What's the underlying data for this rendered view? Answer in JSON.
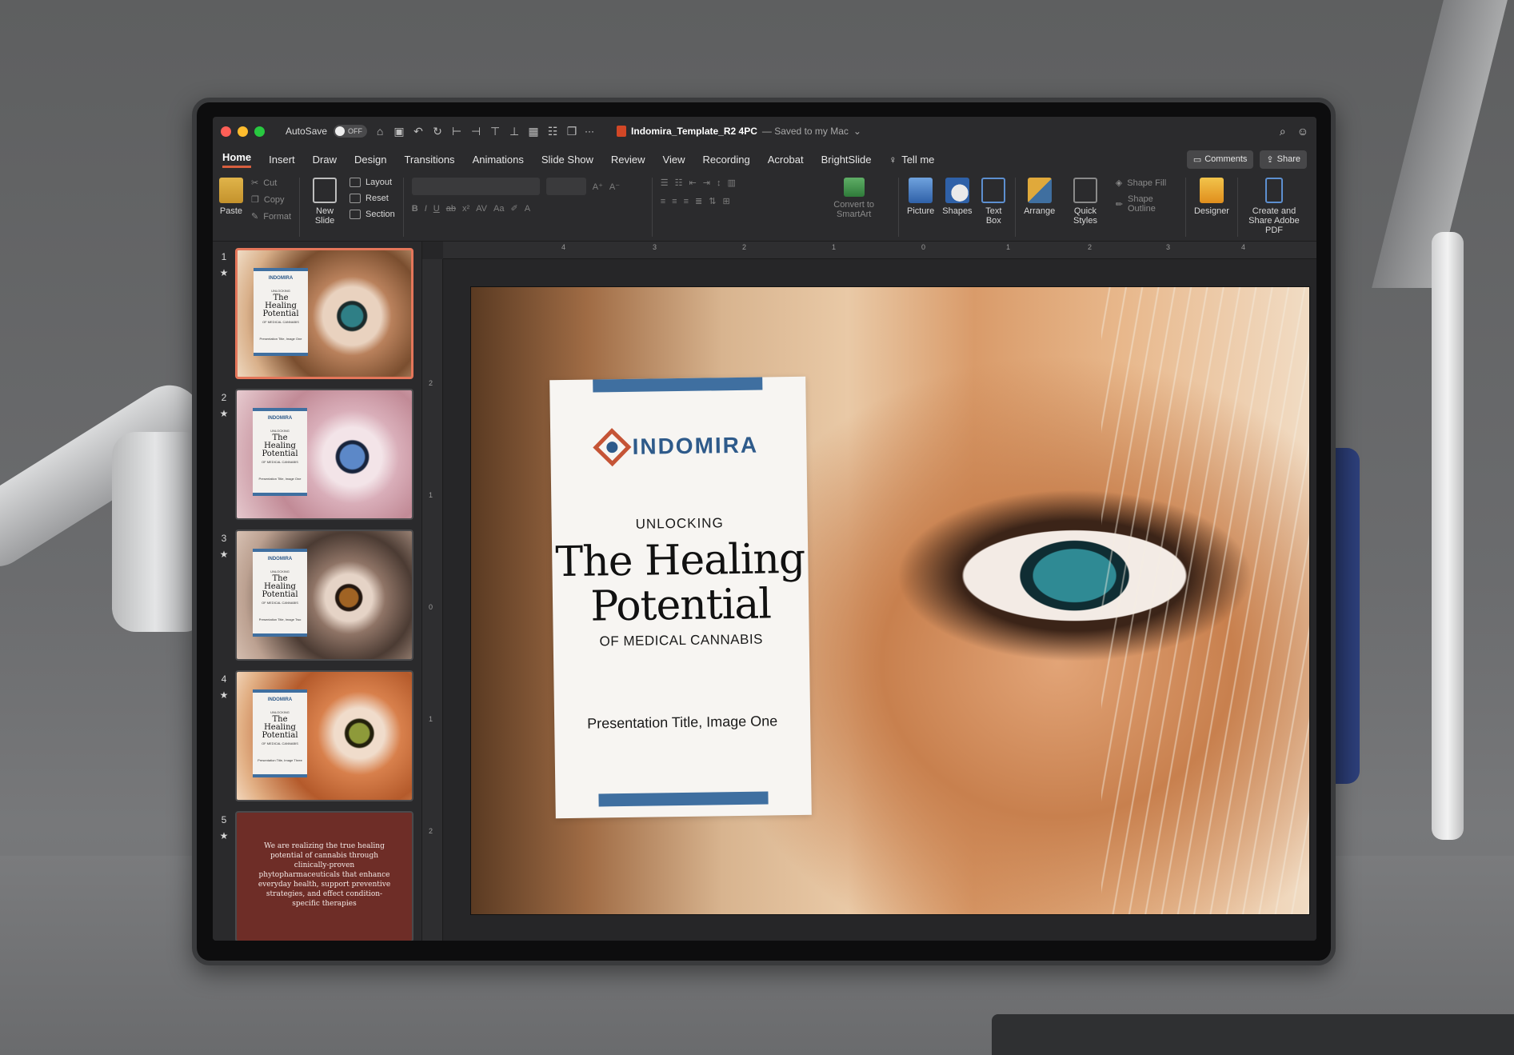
{
  "titlebar": {
    "autosave_label": "AutoSave",
    "autosave_state": "OFF",
    "doc_name": "Indomira_Template_R2 4PC",
    "doc_status": "— Saved to my Mac",
    "more": "···"
  },
  "tabs": [
    "Home",
    "Insert",
    "Draw",
    "Design",
    "Transitions",
    "Animations",
    "Slide Show",
    "Review",
    "View",
    "Recording",
    "Acrobat",
    "BrightSlide"
  ],
  "tellme": "Tell me",
  "comments_label": "Comments",
  "share_label": "Share",
  "ribbon": {
    "paste": "Paste",
    "cut": "Cut",
    "copy": "Copy",
    "format": "Format",
    "new_slide": "New Slide",
    "layout": "Layout",
    "reset": "Reset",
    "section": "Section",
    "convert_smartart": "Convert to SmartArt",
    "picture": "Picture",
    "shapes": "Shapes",
    "text_box": "Text Box",
    "arrange": "Arrange",
    "quick_styles": "Quick Styles",
    "shape_fill": "Shape Fill",
    "shape_outline": "Shape Outline",
    "designer": "Designer",
    "create_share_pdf": "Create and Share Adobe PDF"
  },
  "ruler_h_labels": [
    "4",
    "3",
    "2",
    "1",
    "0",
    "1",
    "2",
    "3",
    "4"
  ],
  "ruler_v_labels": [
    "2",
    "1",
    "0",
    "1",
    "2"
  ],
  "thumbnails": [
    {
      "num": "1",
      "logo": "INDOMIRA",
      "small": "UNLOCKING",
      "big": "The Healing Potential",
      "sub": "OF MEDICAL CANNABIS",
      "foot": "Presentation Title, Image One"
    },
    {
      "num": "2",
      "logo": "INDOMIRA",
      "small": "UNLOCKING",
      "big": "The Healing Potential",
      "sub": "OF MEDICAL CANNABIS",
      "foot": "Presentation Title, Image One"
    },
    {
      "num": "3",
      "logo": "INDOMIRA",
      "small": "UNLOCKING",
      "big": "The Healing Potential",
      "sub": "OF MEDICAL CANNABIS",
      "foot": "Presentation Title, Image Two"
    },
    {
      "num": "4",
      "logo": "INDOMIRA",
      "small": "UNLOCKING",
      "big": "The Healing Potential",
      "sub": "OF MEDICAL CANNABIS",
      "foot": "Presentation Title, Image Three"
    },
    {
      "num": "5",
      "quote": "We are realizing the true healing potential of cannabis through clinically-proven phytopharmaceuticals that enhance everyday health, support preventive strategies, and effect condition-specific therapies"
    }
  ],
  "slide": {
    "logo": "INDOMIRA",
    "unlocking": "UNLOCKING",
    "headline_line1": "The Healing",
    "headline_line2": "Potential",
    "subline": "OF MEDICAL CANNABIS",
    "presentation_title": "Presentation Title, Image One"
  },
  "colors": {
    "accent_tab": "#d75f3f",
    "brand_blue": "#2e5a8a",
    "brand_orange": "#c55436",
    "selected_thumb": "#e4765a",
    "quote_bg": "#6e2d27"
  }
}
